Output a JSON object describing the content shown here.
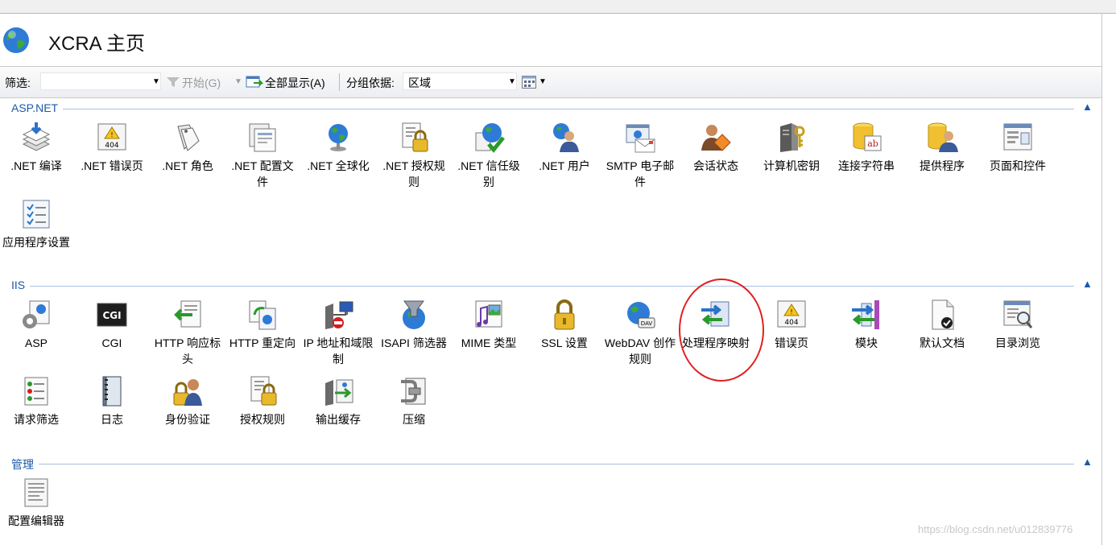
{
  "header": {
    "title": "XCRA 主页"
  },
  "toolbar": {
    "filter_label": "筛选:",
    "start_label": "开始(G)",
    "show_all_label": "全部显示(A)",
    "group_label": "分组依据:",
    "group_value": "区域"
  },
  "sections": {
    "aspnet": {
      "title": "ASP.NET",
      "items": [
        {
          "label": ".NET 编译",
          "icon": "dotnet-compile-icon"
        },
        {
          "label": ".NET 错误页",
          "icon": "dotnet-error-pages-icon"
        },
        {
          "label": ".NET 角色",
          "icon": "dotnet-roles-icon"
        },
        {
          "label": ".NET 配置文件",
          "icon": "dotnet-profile-icon"
        },
        {
          "label": ".NET 全球化",
          "icon": "dotnet-globalization-icon"
        },
        {
          "label": ".NET 授权规则",
          "icon": "dotnet-authorization-icon"
        },
        {
          "label": ".NET 信任级别",
          "icon": "dotnet-trust-level-icon"
        },
        {
          "label": ".NET 用户",
          "icon": "dotnet-users-icon"
        },
        {
          "label": "SMTP 电子邮件",
          "icon": "smtp-email-icon"
        },
        {
          "label": "会话状态",
          "icon": "session-state-icon"
        },
        {
          "label": "计算机密钥",
          "icon": "machine-key-icon"
        },
        {
          "label": "连接字符串",
          "icon": "connection-strings-icon"
        },
        {
          "label": "提供程序",
          "icon": "providers-icon"
        },
        {
          "label": "页面和控件",
          "icon": "pages-controls-icon"
        },
        {
          "label": "应用程序设置",
          "icon": "app-settings-icon"
        }
      ]
    },
    "iis": {
      "title": "IIS",
      "items": [
        {
          "label": "ASP",
          "icon": "asp-icon"
        },
        {
          "label": "CGI",
          "icon": "cgi-icon"
        },
        {
          "label": "HTTP 响应标头",
          "icon": "http-headers-icon"
        },
        {
          "label": "HTTP 重定向",
          "icon": "http-redirect-icon"
        },
        {
          "label": "IP 地址和域限制",
          "icon": "ip-restrictions-icon"
        },
        {
          "label": "ISAPI 筛选器",
          "icon": "isapi-filters-icon"
        },
        {
          "label": "MIME 类型",
          "icon": "mime-types-icon"
        },
        {
          "label": "SSL 设置",
          "icon": "ssl-lock-icon"
        },
        {
          "label": "WebDAV 创作规则",
          "icon": "webdav-icon"
        },
        {
          "label": "处理程序映射",
          "icon": "handler-mappings-icon"
        },
        {
          "label": "错误页",
          "icon": "error-pages-icon"
        },
        {
          "label": "模块",
          "icon": "modules-icon"
        },
        {
          "label": "默认文档",
          "icon": "default-document-icon"
        },
        {
          "label": "目录浏览",
          "icon": "directory-browsing-icon"
        },
        {
          "label": "请求筛选",
          "icon": "request-filtering-icon"
        },
        {
          "label": "日志",
          "icon": "logging-icon"
        },
        {
          "label": "身份验证",
          "icon": "authentication-icon"
        },
        {
          "label": "授权规则",
          "icon": "authorization-rules-icon"
        },
        {
          "label": "输出缓存",
          "icon": "output-caching-icon"
        },
        {
          "label": "压缩",
          "icon": "compression-icon"
        }
      ]
    },
    "management": {
      "title": "管理",
      "items": [
        {
          "label": "配置编辑器",
          "icon": "config-editor-icon"
        }
      ]
    }
  },
  "watermark": "https://blog.csdn.net/u012839776",
  "colors": {
    "section_title": "#1a5aa8",
    "highlight_circle": "#e02020"
  }
}
